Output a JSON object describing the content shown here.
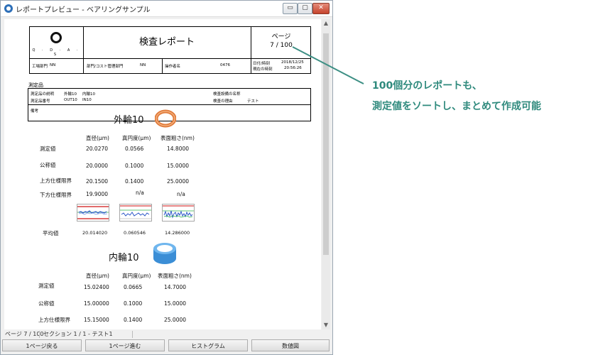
{
  "window": {
    "title": "レポートプレビュー - ベアリングサンプル",
    "minimize_label": "▭",
    "maximize_label": "▢",
    "close_label": "✕"
  },
  "report": {
    "logo_text": "Q · D · A · S",
    "title": "検査レポート",
    "page_label": "ページ",
    "page_number": "7 / 100",
    "info": {
      "dept_label": "工場部門",
      "dept_value": "NN",
      "cost_label": "部門/コスト管理部門",
      "cost_value": "NN",
      "operator_label": "操作者名",
      "operator_value": "0476",
      "date_label": "日付/時刻",
      "date_value": "2018/12/25",
      "current_label": "現在の時刻",
      "current_value": "20:56:26"
    },
    "measured_label": "測定品",
    "part": {
      "desc_label": "測定品の説明",
      "desc_value": "外輪10",
      "desc_value2": "内輪10",
      "number_label": "測定品番号",
      "number_value": "OUT10",
      "number_value2": "IN10",
      "machine_label": "検査設備の名称",
      "reason_label": "検査の理由",
      "reason_value": "テスト"
    },
    "remarks_label": "備考"
  },
  "outer": {
    "title": "外輪10",
    "headers": [
      "直径(μm)",
      "真円度(μm)",
      "表面粗さ(nm)"
    ],
    "rows": [
      {
        "label": "測定値",
        "values": [
          "20.0270",
          "0.0566",
          "14.8000"
        ]
      },
      {
        "label": "公称値",
        "values": [
          "20.0000",
          "0.1000",
          "15.0000"
        ]
      },
      {
        "label": "上方仕様限界",
        "values": [
          "20.1500",
          "0.1400",
          "25.0000"
        ]
      },
      {
        "label": "下方仕様限界",
        "values": [
          "19.9000",
          "n/a",
          "n/a"
        ]
      }
    ],
    "mean_label": "平均値",
    "means": [
      "20.014020",
      "0.060546",
      "14.286000"
    ]
  },
  "inner": {
    "title": "内輪10",
    "headers": [
      "直径(μm)",
      "真円度(μm)",
      "表面粗さ(nm)"
    ],
    "rows": [
      {
        "label": "測定値",
        "values": [
          "15.02400",
          "0.0665",
          "14.7000"
        ]
      },
      {
        "label": "公称値",
        "values": [
          "15.00000",
          "0.1000",
          "15.0000"
        ]
      },
      {
        "label": "上方仕様限界",
        "values": [
          "15.15000",
          "0.1400",
          "25.0000"
        ]
      }
    ]
  },
  "status": {
    "page": "ページ 7 / 100",
    "section": "セクション 1 / 1 - テスト1"
  },
  "buttons": {
    "back": "1ページ戻る",
    "forward": "1ページ進む",
    "histogram": "ヒストグラム",
    "values_chart": "数値図"
  },
  "callout": {
    "line1": "100個分のレポートも、",
    "line2": "測定値をソートし、まとめて作成可能"
  },
  "colors": {
    "accent": "#2f8a7d",
    "outer_ring": "#e07a3a",
    "inner_ring": "#3b8ed6"
  }
}
